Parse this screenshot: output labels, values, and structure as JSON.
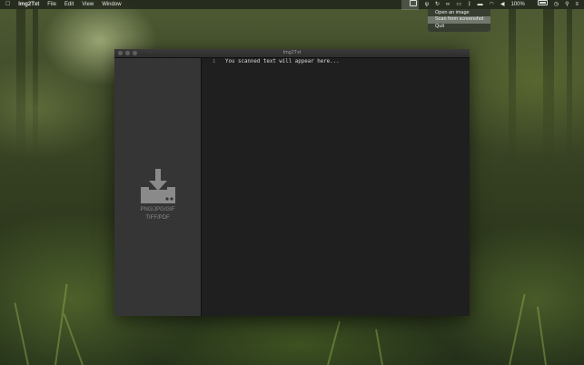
{
  "menubar": {
    "apple_icon": "apple-icon",
    "app_name": "Img2Txt",
    "menus": [
      "File",
      "Edit",
      "View",
      "Window"
    ],
    "status": {
      "battery": "100%"
    }
  },
  "status_menu": {
    "items": [
      "Open an image",
      "Scan from screenshot",
      "Quit"
    ],
    "highlighted_index": 1
  },
  "window": {
    "title": "Img2Txt",
    "drop_zone": {
      "icon": "download-icon",
      "line1": "PNG/JPG/GIF",
      "line2": "TIFF/PDF"
    },
    "editor": {
      "line_number": "1",
      "placeholder_text": "You scanned text will appear here..."
    }
  },
  "colors": {
    "window_bg": "#1c1c1c",
    "sidebar_bg": "#353535",
    "icon_gray": "#8a8a8a",
    "menu_highlight": "#787d73"
  }
}
